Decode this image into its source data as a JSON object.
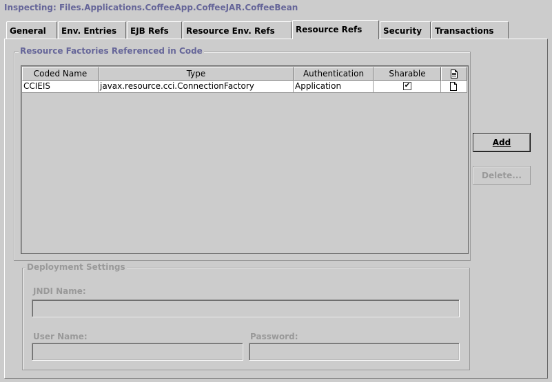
{
  "inspecting_path": "Inspecting: Files.Applications.CoffeeApp.CoffeeJAR.CoffeeBean",
  "tabs": [
    {
      "label": "General"
    },
    {
      "label": "Env. Entries"
    },
    {
      "label": "EJB Refs"
    },
    {
      "label": "Resource Env. Refs"
    },
    {
      "label": "Resource Refs"
    },
    {
      "label": "Security"
    },
    {
      "label": "Transactions"
    }
  ],
  "selected_tab": "Resource Refs",
  "resource_factories": {
    "title": "Resource Factories Referenced in Code",
    "columns": [
      "Coded Name",
      "Type",
      "Authentication",
      "Sharable"
    ],
    "last_column_icon": "document-icon",
    "rows": [
      {
        "coded_name": "CCIEIS",
        "type": "javax.resource.cci.ConnectionFactory",
        "authentication": "Application",
        "sharable": true,
        "sharable_mark": "✔",
        "row_icon": "document-icon"
      }
    ]
  },
  "buttons": {
    "add": {
      "label": "Add",
      "enabled": true
    },
    "delete": {
      "label": "Delete...",
      "enabled": false
    }
  },
  "deployment_settings": {
    "title": "Deployment Settings",
    "jndi_label": "JNDI Name:",
    "jndi_value": "",
    "user_label": "User Name:",
    "user_value": "",
    "password_label": "Password:",
    "password_value": ""
  },
  "colors": {
    "background": "#cccccc",
    "title_text": "#666699",
    "disabled_text": "#999999",
    "row_background": "#ffffff"
  }
}
